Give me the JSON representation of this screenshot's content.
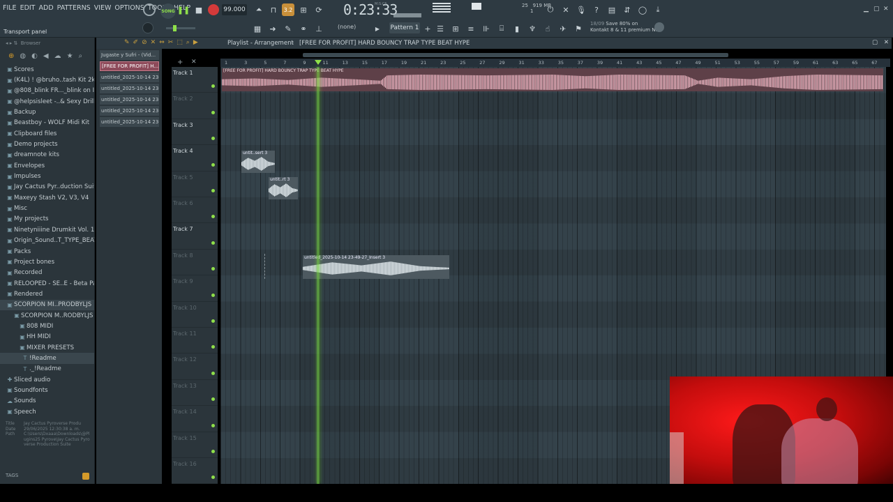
{
  "menu": [
    "FILE",
    "EDIT",
    "ADD",
    "PATTERNS",
    "VIEW",
    "OPTIONS",
    "TOOLS",
    "HELP"
  ],
  "transport": {
    "song_label": "SONG",
    "tempo": "99.000",
    "time": "0:23:33",
    "time_unit": "M:S:CS",
    "panel_label": "Transport panel",
    "pattern": "Pattern 1",
    "none_label": "(none)",
    "memory": "919 MB",
    "cpu_num": "25",
    "voices": "1"
  },
  "hint": {
    "date": "18/09",
    "text1": "Save 80% on",
    "text2": "Kontakt 8 & 11 premium N..."
  },
  "browser": {
    "title": "Browser",
    "items": [
      {
        "label": "Scores",
        "icon": "folder-icon"
      },
      {
        "label": "(K4L) ! @bruho..tash Kit 2k24",
        "icon": "folder-icon"
      },
      {
        "label": "@808_blink FR..._blink on IG)",
        "icon": "folder-icon"
      },
      {
        "label": "@helpsisleet -..& Sexy Drill)",
        "icon": "folder-icon"
      },
      {
        "label": "Backup",
        "icon": "folder-icon"
      },
      {
        "label": "Beastboy - WOLF Midi Kit",
        "icon": "folder-icon"
      },
      {
        "label": "Clipboard files",
        "icon": "folder-icon"
      },
      {
        "label": "Demo projects",
        "icon": "folder-icon"
      },
      {
        "label": "dreamnote kits",
        "icon": "folder-icon"
      },
      {
        "label": "Envelopes",
        "icon": "folder-icon"
      },
      {
        "label": "Impulses",
        "icon": "folder-icon"
      },
      {
        "label": "Jay Cactus Pyr..duction Suite",
        "icon": "folder-icon"
      },
      {
        "label": "Maxeyy Stash V2, V3, V4",
        "icon": "folder-icon"
      },
      {
        "label": "Misc",
        "icon": "folder-icon"
      },
      {
        "label": "My projects",
        "icon": "folder-icon"
      },
      {
        "label": "Ninetyniiine Drumkit Vol. 1",
        "icon": "folder-icon"
      },
      {
        "label": "Origin_Sound..T_TYPE_BEATS",
        "icon": "folder-icon"
      },
      {
        "label": "Packs",
        "icon": "folder-icon"
      },
      {
        "label": "Project bones",
        "icon": "folder-icon"
      },
      {
        "label": "Recorded",
        "icon": "folder-icon"
      },
      {
        "label": "RELOOPED - SE..E - Beta Pack",
        "icon": "folder-icon"
      },
      {
        "label": "Rendered",
        "icon": "folder-icon"
      },
      {
        "label": "SCORPION MI..PRODBYLJS",
        "icon": "folder-icon"
      },
      {
        "label": "SCORPION M..RODBYLJS",
        "icon": "folder-icon"
      },
      {
        "label": "808 MIDI",
        "icon": "folder-icon"
      },
      {
        "label": "HH MIDI",
        "icon": "folder-icon"
      },
      {
        "label": "MIXER PRESETS",
        "icon": "folder-icon"
      },
      {
        "label": "!Readme",
        "icon": "text-file-icon"
      },
      {
        "label": "._!Readme",
        "icon": "text-file-icon"
      },
      {
        "label": "Sliced audio",
        "icon": "plus-folder-icon"
      },
      {
        "label": "Soundfonts",
        "icon": "folder-icon"
      },
      {
        "label": "Sounds",
        "icon": "cloud-icon"
      },
      {
        "label": "Speech",
        "icon": "folder-icon"
      }
    ],
    "info": {
      "title_key": "Title",
      "title_val": "Jay Cactus Pyroverse Produ",
      "date_key": "Date",
      "date_val": "29/06/2025 12:30:38 a. m.",
      "path_key": "Path",
      "path_val": "C:\\Users\\Dxaaa\\Downloads\\@Plugins25 Pyrove\\Jay Cactus Pyroverse Production Suite"
    },
    "tags_label": "TAGS"
  },
  "picker": {
    "items": [
      "Jugaste y Sufri - (Vid...",
      "[FREE FOR PROFIT] H...",
      "untitled_2025-10-14 23-...",
      "untitled_2025-10-14 23-...",
      "untitled_2025-10-14 23-...",
      "untitled_2025-10-14 23-...",
      "untitled_2025-10-14 23-..."
    ]
  },
  "playlist": {
    "title": "Playlist - Arrangement",
    "separator": "›",
    "project": "[FREE FOR PROFIT] HARD BOUNCY TRAP TYPE BEAT HYPE",
    "bars": [
      "1",
      "3",
      "5",
      "7",
      "9",
      "11",
      "13",
      "15",
      "17",
      "19",
      "21",
      "23",
      "25",
      "27",
      "29",
      "31",
      "33",
      "35",
      "37",
      "39",
      "41",
      "43",
      "45",
      "47",
      "49",
      "51",
      "53",
      "55",
      "57",
      "59",
      "61",
      "63",
      "65",
      "67"
    ],
    "tracks": [
      "Track 1",
      "Track 2",
      "Track 3",
      "Track 4",
      "Track 5",
      "Track 6",
      "Track 7",
      "Track 8",
      "Track 9",
      "Track 10",
      "Track 11",
      "Track 12",
      "Track 13",
      "Track 14",
      "Track 15",
      "Track 16"
    ],
    "clips": {
      "main": "[FREE FOR PROFIT] HARD BOUNCY TRAP TYPE BEAT HYPE",
      "t3": "untit..sert 3",
      "t4": "untit..rt 3",
      "t7": "untitled_2025-10-14 23-49-27_Insert 3"
    }
  },
  "colors": {
    "accent_green": "#8fe04a",
    "clip_pink": "#5e4048",
    "record_red": "#d43a3a",
    "webcam_red": "#ff1a1a"
  }
}
